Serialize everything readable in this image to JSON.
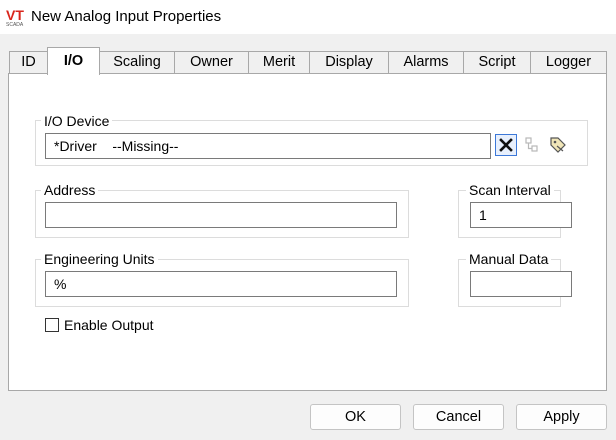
{
  "window": {
    "title": "New Analog Input Properties",
    "logo_text": "VT",
    "logo_subtext": "SCADA",
    "brand_color": "#d9261c"
  },
  "tabs": [
    {
      "label": "ID"
    },
    {
      "label": "I/O",
      "active": true
    },
    {
      "label": "Scaling"
    },
    {
      "label": "Owner"
    },
    {
      "label": "Merit"
    },
    {
      "label": "Display"
    },
    {
      "label": "Alarms"
    },
    {
      "label": "Script"
    },
    {
      "label": "Logger"
    }
  ],
  "io_device": {
    "label": "I/O Device",
    "value": "*Driver    --Missing--",
    "buttons": [
      {
        "icon": "clear-x-icon"
      },
      {
        "icon": "tree-browse-icon"
      },
      {
        "icon": "tag-browse-icon"
      }
    ]
  },
  "address": {
    "label": "Address",
    "value": ""
  },
  "scan_interval": {
    "label": "Scan Interval",
    "value": "1"
  },
  "engineering_units": {
    "label": "Engineering Units",
    "value": "%"
  },
  "manual_data": {
    "label": "Manual Data",
    "value": ""
  },
  "enable_output": {
    "label": "Enable Output",
    "checked": false
  },
  "footer": {
    "ok": "OK",
    "cancel": "Cancel",
    "apply": "Apply"
  }
}
